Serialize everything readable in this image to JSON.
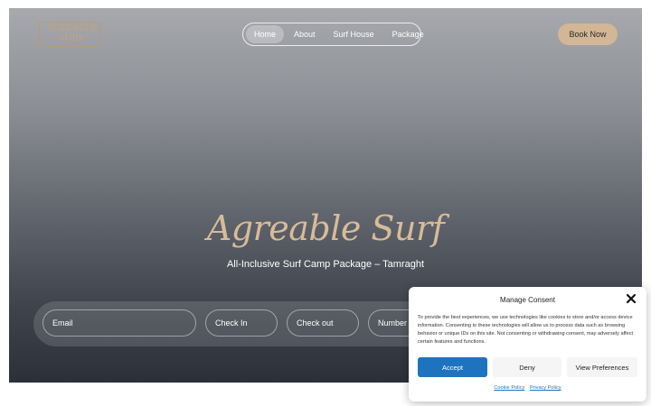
{
  "header": {
    "logo": {
      "line1": "AGREABLE",
      "line2": "SURF"
    },
    "nav": [
      {
        "label": "Home",
        "active": true
      },
      {
        "label": "About",
        "active": false
      },
      {
        "label": "Surf House",
        "active": false
      },
      {
        "label": "Package",
        "active": false
      }
    ],
    "book_label": "Book Now"
  },
  "hero": {
    "title": "Agreable Surf",
    "subtitle": "All-Inclusive Surf Camp Package – Tamraght"
  },
  "booking": {
    "email_label": "Email",
    "checkin_label": "Check In",
    "checkout_label": "Check out",
    "guests_label": "Number of"
  },
  "consent": {
    "title": "Manage Consent",
    "text": "To provide the best experiences, we use technologies like cookies to store and/or access device information. Consenting to these technologies will allow us to process data such as browsing behavior or unique IDs on this site. Not consenting or withdrawing consent, may adversely affect certain features and functions.",
    "accept_label": "Accept",
    "deny_label": "Deny",
    "prefs_label": "View Preferences",
    "cookie_policy": "Cookie Policy",
    "privacy_policy": "Privacy Policy"
  },
  "colors": {
    "accent": "#d2b696",
    "title_color": "#d8bb98",
    "primary_button": "#1e73be"
  }
}
